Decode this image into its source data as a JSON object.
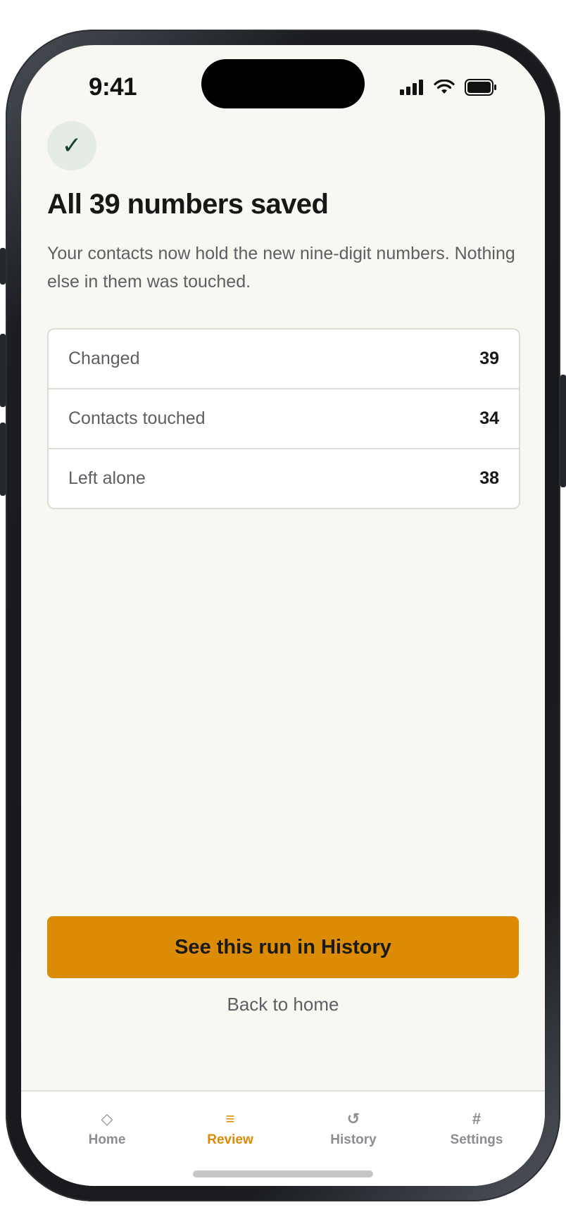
{
  "status_bar": {
    "time": "9:41"
  },
  "header": {
    "title": "All 39 numbers saved",
    "subtitle": "Your contacts now hold the new nine-digit numbers. Nothing else in them was touched."
  },
  "stats": [
    {
      "label": "Changed",
      "value": "39"
    },
    {
      "label": "Contacts touched",
      "value": "34"
    },
    {
      "label": "Left alone",
      "value": "38"
    }
  ],
  "actions": {
    "primary_label": "See this run in History",
    "secondary_label": "Back to home"
  },
  "tabbar": {
    "active": "Review",
    "items": [
      {
        "label": "Home",
        "icon": "◇",
        "icon_name": "diamond-icon"
      },
      {
        "label": "Review",
        "icon": "≡",
        "icon_name": "list-icon"
      },
      {
        "label": "History",
        "icon": "↺",
        "icon_name": "history-icon"
      },
      {
        "label": "Settings",
        "icon": "#",
        "icon_name": "hash-icon"
      }
    ]
  },
  "colors": {
    "accent": "#dc8b05",
    "background": "#f9f7f1",
    "success_check": "#17412c"
  }
}
